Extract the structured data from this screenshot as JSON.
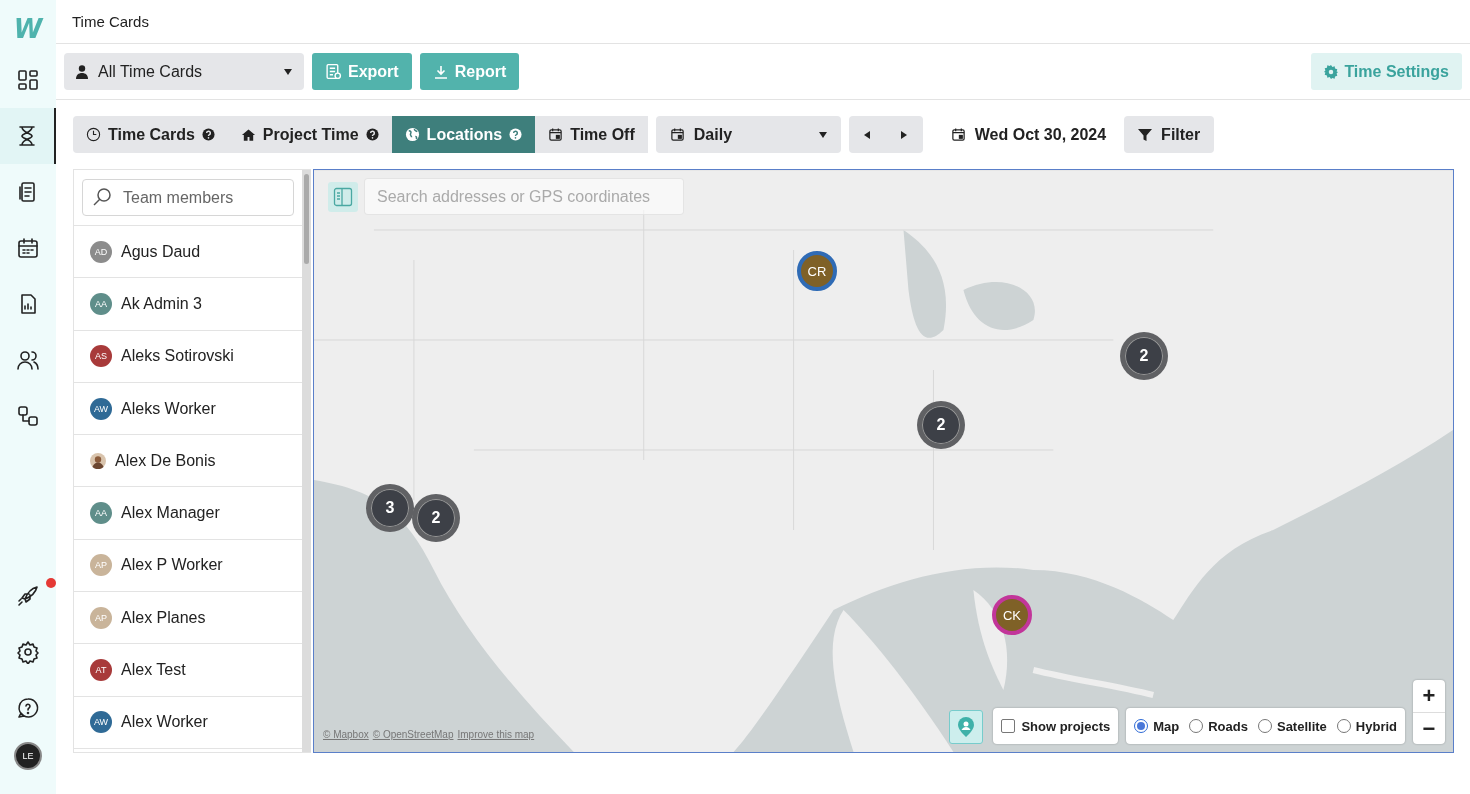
{
  "logo": "W",
  "nav_rail": {
    "items": [
      {
        "kind": "dashboard",
        "selected": false,
        "notification": false
      },
      {
        "kind": "timer",
        "selected": true,
        "notification": false
      },
      {
        "kind": "documents",
        "selected": false,
        "notification": false
      },
      {
        "kind": "calendar",
        "selected": false,
        "notification": false
      },
      {
        "kind": "report",
        "selected": false,
        "notification": false
      },
      {
        "kind": "people",
        "selected": false,
        "notification": false
      },
      {
        "kind": "workflow",
        "selected": false,
        "notification": false
      },
      {
        "kind": "rocket",
        "selected": false,
        "notification": true
      },
      {
        "kind": "settings",
        "selected": false,
        "notification": false
      },
      {
        "kind": "help",
        "selected": false,
        "notification": false
      }
    ],
    "user_avatar": "LE"
  },
  "page_title": "Time Cards",
  "toolbar": {
    "dropdown": "All Time Cards",
    "buttons": [
      {
        "kind": "export",
        "label": "Export"
      },
      {
        "kind": "report",
        "label": "Report"
      }
    ],
    "settings_button": "Time Settings"
  },
  "tabs": [
    {
      "kind": "clock",
      "label": "Time Cards",
      "help": true,
      "selected": false
    },
    {
      "kind": "home",
      "label": "Project Time",
      "help": true,
      "selected": false
    },
    {
      "kind": "globe",
      "label": "Locations",
      "help": true,
      "selected": true
    },
    {
      "kind": "calendar",
      "label": "Time Off",
      "help": false,
      "selected": false
    }
  ],
  "period_dropdown": "Daily",
  "date": "Wed Oct 30, 2024",
  "filter_button": "Filter",
  "team_panel": {
    "search": {
      "placeholder": "Team members"
    },
    "members": [
      {
        "kind": "initials",
        "name": "Agus Daud",
        "initials": "AD",
        "color": "#8c8c8c"
      },
      {
        "kind": "initials",
        "name": "Ak Admin 3",
        "initials": "AA",
        "color": "#5f8e8a"
      },
      {
        "kind": "initials",
        "name": "Aleks Sotirovski",
        "initials": "AS",
        "color": "#a83a3a"
      },
      {
        "kind": "initials",
        "name": "Aleks Worker",
        "initials": "AW",
        "color": "#2f6a96"
      },
      {
        "name": "Alex De Bonis"
      },
      {
        "kind": "initials",
        "name": "Alex Manager",
        "initials": "AA",
        "color": "#5f8e8a"
      },
      {
        "kind": "initials",
        "name": "Alex P Worker",
        "initials": "AP",
        "color": "#c9b49a"
      },
      {
        "kind": "initials",
        "name": "Alex Planes",
        "initials": "AP",
        "color": "#c9b49a"
      },
      {
        "kind": "initials",
        "name": "Alex Test",
        "initials": "AT",
        "color": "#a83a3a"
      },
      {
        "kind": "initials",
        "name": "Alex Worker",
        "initials": "AW",
        "color": "#2f6a96"
      }
    ]
  },
  "map": {
    "search": {
      "placeholder": "Search addresses or GPS coordinates"
    },
    "markers": [
      {
        "kind": "person",
        "label": "CR",
        "color": "#2f6bb5"
      },
      {
        "kind": "cluster",
        "label": "2"
      },
      {
        "kind": "cluster",
        "label": "2"
      },
      {
        "kind": "cluster",
        "label": "3"
      },
      {
        "kind": "cluster",
        "label": "2"
      },
      {
        "kind": "person",
        "label": "CK",
        "color": "#c2359a"
      }
    ],
    "attribution": [
      "© Mapbox",
      "© OpenStreetMap",
      "Improve this map"
    ],
    "show_projects": {
      "label": "Show projects",
      "checked": false
    },
    "map_types": [
      {
        "label": "Map",
        "selected": true
      },
      {
        "label": "Roads",
        "selected": false
      },
      {
        "label": "Satellite",
        "selected": false
      },
      {
        "label": "Hybrid",
        "selected": false
      }
    ],
    "zoom": [
      "+",
      "−"
    ]
  }
}
